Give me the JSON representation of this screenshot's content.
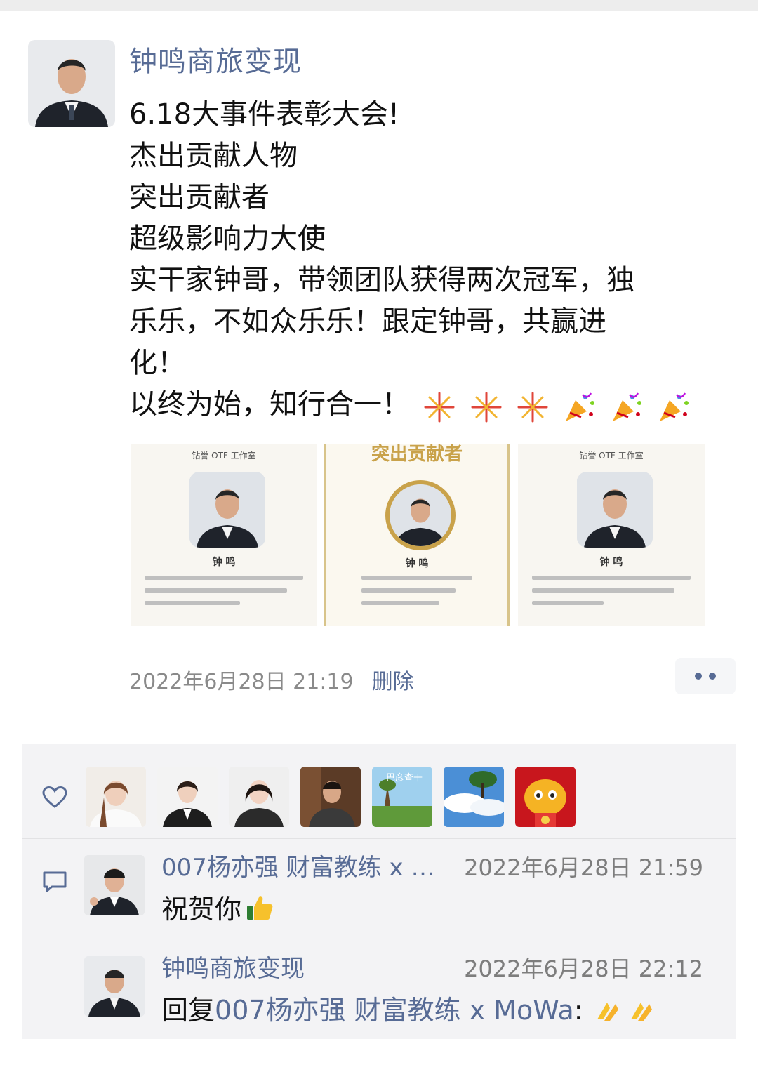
{
  "post": {
    "author": "钟鸣商旅变现",
    "lines": [
      "6.18大事件表彰大会!",
      "杰出贡献人物",
      "突出贡献者",
      "超级影响力大使",
      "实干家钟哥，带领团队获得两次冠军，独",
      "乐乐，不如众乐乐！跟定钟哥，共赢进",
      "化！",
      "以终为始，知行合一！"
    ],
    "emojis": [
      "fireworks-icon",
      "fireworks-icon",
      "fireworks-icon",
      "party-popper-icon",
      "party-popper-icon",
      "party-popper-icon"
    ],
    "images": [
      {
        "label": "钻誉 OTF 工作室",
        "name": "钟 鸣"
      },
      {
        "label": "突出贡献者",
        "name": "钟 鸣"
      },
      {
        "label": "钻誉 OTF 工作室",
        "name": "钟 鸣"
      }
    ],
    "timestamp": "2022年6月28日 21:19",
    "delete_label": "删除",
    "more_icon": "more-dots-icon"
  },
  "likes": {
    "icon": "heart-icon",
    "avatars": [
      "liker-avatar-1",
      "liker-avatar-2",
      "liker-avatar-3",
      "liker-avatar-4",
      "liker-avatar-5",
      "liker-avatar-6",
      "liker-avatar-7"
    ],
    "landscape_text": "巴彦查干"
  },
  "comments": {
    "icon": "comment-icon",
    "items": [
      {
        "name": "007杨亦强 财富教练 x …",
        "time": "2022年6月28日 21:59",
        "text": "祝贺你",
        "emoji": "thumbs-up-icon"
      },
      {
        "name": "钟鸣商旅变现",
        "time": "2022年6月28日 22:12",
        "reply_prefix": "回复",
        "reply_target": "007杨亦强 财富教练 x MoWa",
        "reply_suffix": ":",
        "emoji": "folded-hands-icon"
      }
    ]
  },
  "colors": {
    "link": "#576b95",
    "panel": "#f3f3f5",
    "text": "#111111",
    "meta": "#8a8a8a"
  }
}
